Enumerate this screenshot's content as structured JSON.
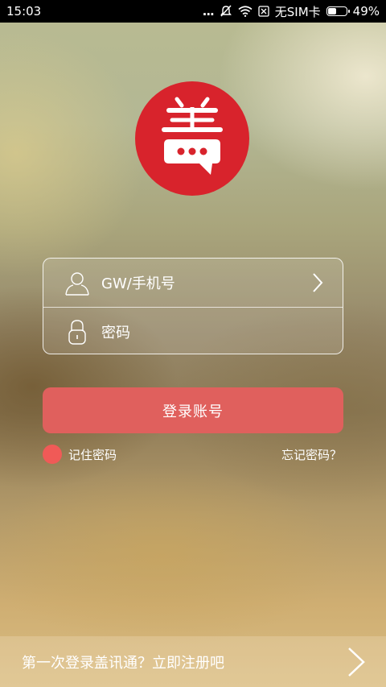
{
  "status_bar": {
    "time": "15:03",
    "dots": "...",
    "sim_text": "无SIM卡",
    "battery": "49%",
    "battery_level": 0.49
  },
  "login_form": {
    "username_placeholder": "GW/手机号",
    "password_placeholder": "密码"
  },
  "actions": {
    "login_label": "登录账号",
    "remember_label": "记住密码",
    "forgot_label": "忘记密码？"
  },
  "footer": {
    "register_text": "第一次登录盖讯通？立即注册吧"
  },
  "colors": {
    "brand_red": "#d8232c",
    "button": "#e0605d",
    "remember_dot": "#f05a57"
  },
  "icons": [
    "user-icon",
    "lock-icon",
    "chevron-right-icon",
    "wifi-icon",
    "mute-icon",
    "sim-icon",
    "battery-icon"
  ]
}
